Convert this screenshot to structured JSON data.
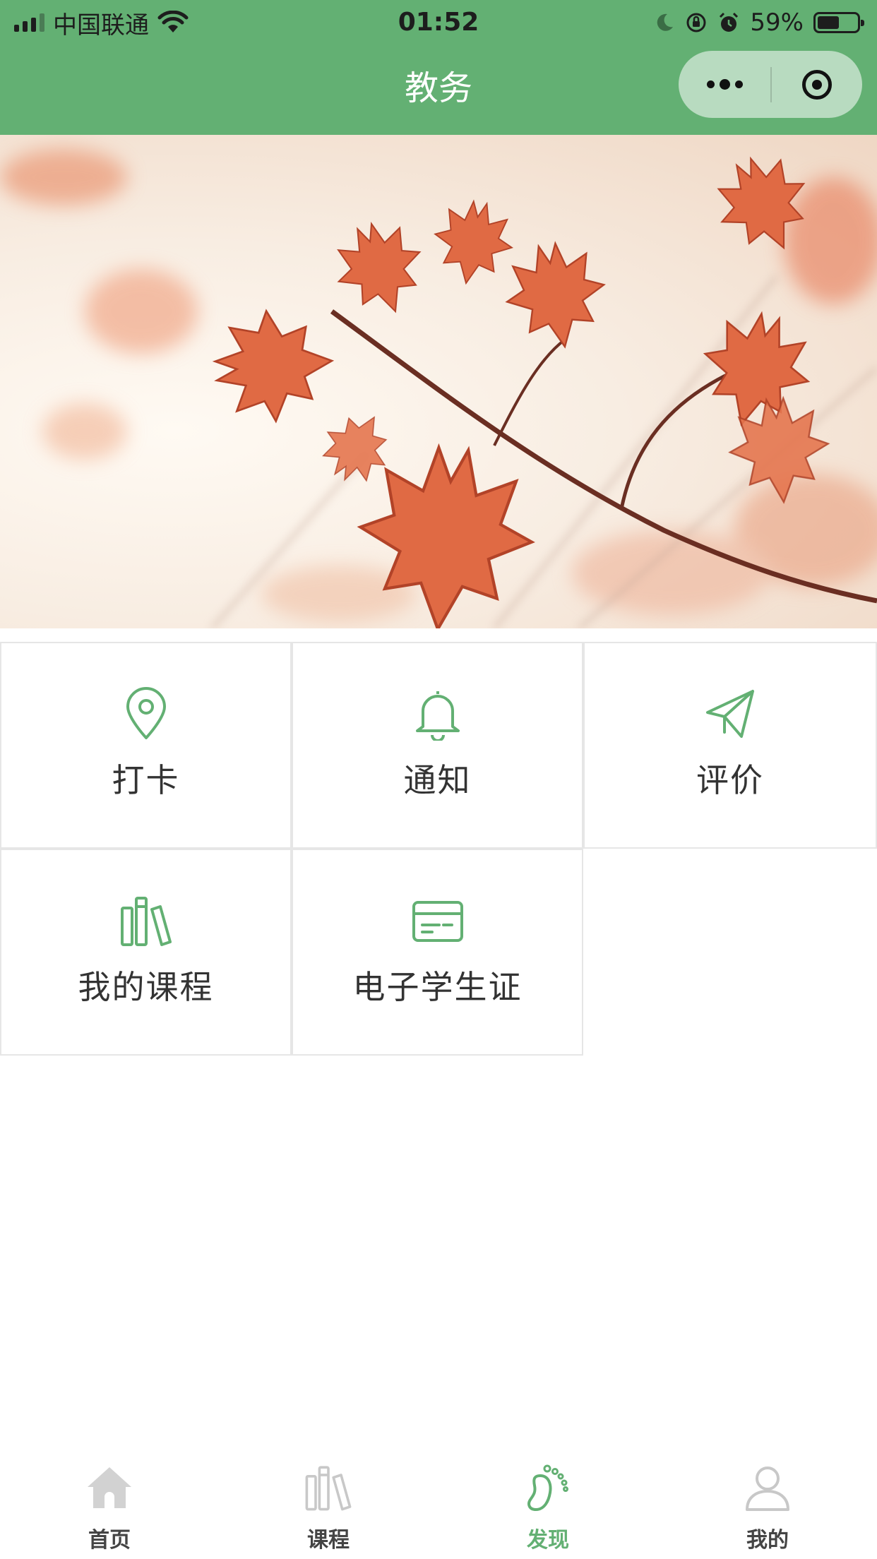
{
  "status_bar": {
    "carrier": "中国联通",
    "time": "01:52",
    "battery": "59%",
    "battery_level": 0.59
  },
  "nav": {
    "title": "教务"
  },
  "menu": {
    "items": [
      {
        "label": "打卡",
        "icon": "location-pin-icon"
      },
      {
        "label": "通知",
        "icon": "bell-icon"
      },
      {
        "label": "评价",
        "icon": "paper-plane-icon"
      },
      {
        "label": "我的课程",
        "icon": "books-icon"
      },
      {
        "label": "电子学生证",
        "icon": "card-icon"
      }
    ]
  },
  "tabbar": {
    "items": [
      {
        "label": "首页",
        "icon": "home-icon",
        "active": false
      },
      {
        "label": "课程",
        "icon": "books-icon",
        "active": false
      },
      {
        "label": "发现",
        "icon": "footprint-icon",
        "active": true
      },
      {
        "label": "我的",
        "icon": "person-icon",
        "active": false
      }
    ]
  },
  "colors": {
    "accent": "#63b073",
    "text": "#333333",
    "inactive_icon": "#c8c8c8"
  }
}
